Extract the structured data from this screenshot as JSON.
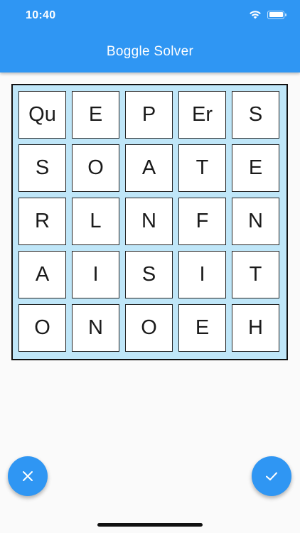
{
  "status_bar": {
    "time": "10:40"
  },
  "app_bar": {
    "title": "Boggle Solver"
  },
  "board": {
    "rows": [
      [
        "Qu",
        "E",
        "P",
        "Er",
        "S"
      ],
      [
        "S",
        "O",
        "A",
        "T",
        "E"
      ],
      [
        "R",
        "L",
        "N",
        "F",
        "N"
      ],
      [
        "A",
        "I",
        "S",
        "I",
        "T"
      ],
      [
        "O",
        "N",
        "O",
        "E",
        "H"
      ]
    ]
  },
  "colors": {
    "primary": "#2f96f3",
    "board_background": "#bfe6f8",
    "tile_background": "#ffffff"
  },
  "icons": {
    "clear_fab": "close-icon",
    "solve_fab": "check-icon"
  }
}
